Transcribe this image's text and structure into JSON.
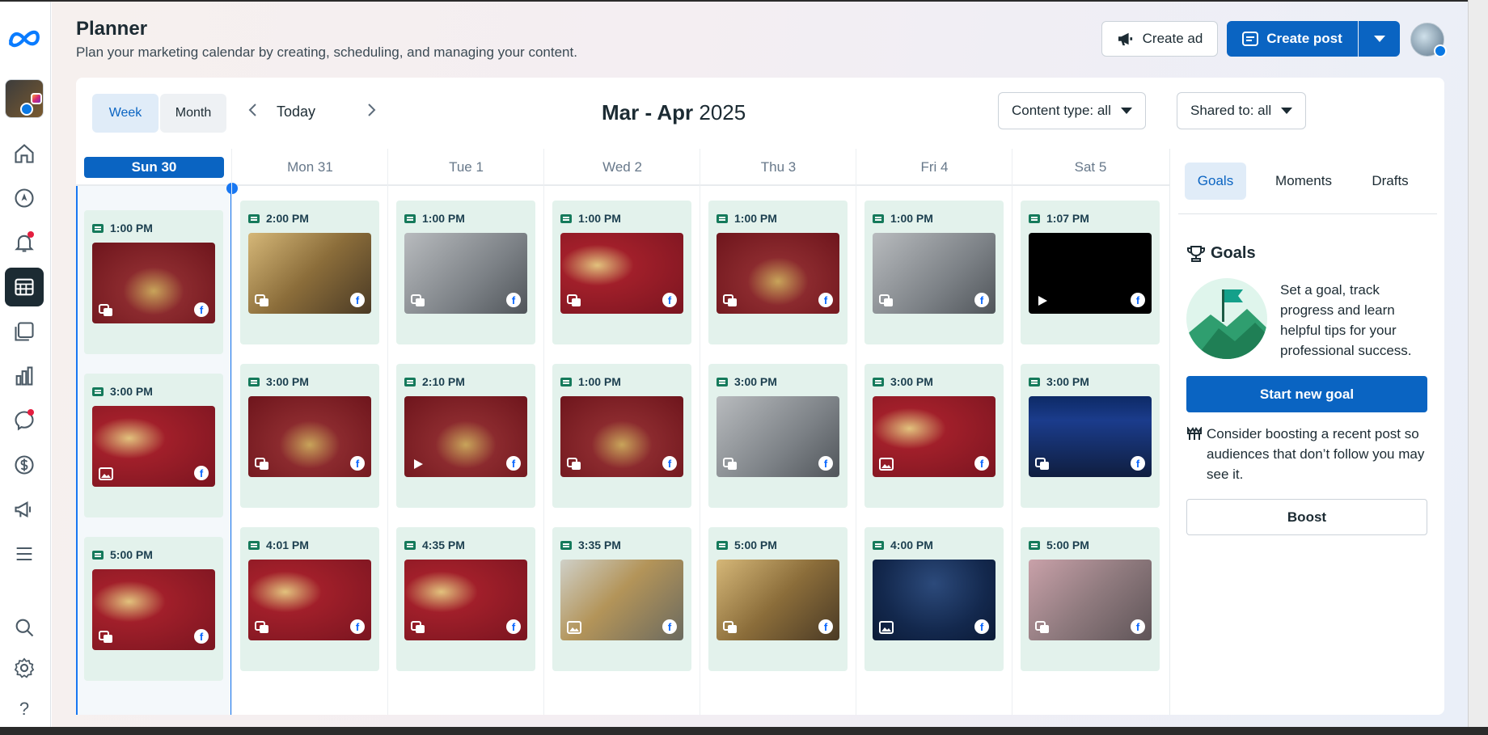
{
  "header": {
    "title": "Planner",
    "subtitle": "Plan your marketing calendar by creating, scheduling, and managing your content.",
    "create_ad_label": "Create ad",
    "create_post_label": "Create post"
  },
  "rail": {
    "icons": [
      "meta-logo-icon",
      "account-avatar",
      "home-icon",
      "compass-icon",
      "bell-icon",
      "planner-icon",
      "content-icon",
      "insights-icon",
      "inbox-icon",
      "monetization-icon",
      "ads-icon",
      "menu-icon",
      "search-icon",
      "settings-icon",
      "help-icon"
    ]
  },
  "toolbar": {
    "week_label": "Week",
    "month_label": "Month",
    "today_label": "Today",
    "range_bold": "Mar - Apr",
    "range_year": "2025",
    "content_type_label": "Content type: all",
    "shared_to_label": "Shared to: all"
  },
  "calendar": {
    "days": [
      {
        "label": "Sun 30",
        "today": true
      },
      {
        "label": "Mon 31"
      },
      {
        "label": "Tue 1"
      },
      {
        "label": "Wed 2"
      },
      {
        "label": "Thu 3"
      },
      {
        "label": "Fri 4"
      },
      {
        "label": "Sat 5"
      }
    ],
    "posts": [
      [
        {
          "time": "1:00 PM",
          "thumb": "th-red",
          "type": "carousel"
        },
        {
          "time": "3:00 PM",
          "thumb": "th-red2",
          "type": "photo"
        },
        {
          "time": "5:00 PM",
          "thumb": "th-red2",
          "type": "carousel"
        }
      ],
      [
        {
          "time": "2:00 PM",
          "thumb": "th-gold",
          "type": "carousel"
        },
        {
          "time": "3:00 PM",
          "thumb": "th-red",
          "type": "carousel"
        },
        {
          "time": "4:01 PM",
          "thumb": "th-red2",
          "type": "carousel"
        }
      ],
      [
        {
          "time": "1:00 PM",
          "thumb": "th-grey",
          "type": "carousel"
        },
        {
          "time": "2:10 PM",
          "thumb": "th-red",
          "type": "video"
        },
        {
          "time": "4:35 PM",
          "thumb": "th-red2",
          "type": "carousel"
        }
      ],
      [
        {
          "time": "1:00 PM",
          "thumb": "th-red2",
          "type": "carousel"
        },
        {
          "time": "1:00 PM",
          "thumb": "th-red",
          "type": "carousel"
        },
        {
          "time": "3:35 PM",
          "thumb": "th-teal",
          "type": "photo"
        }
      ],
      [
        {
          "time": "1:00 PM",
          "thumb": "th-red",
          "type": "carousel"
        },
        {
          "time": "3:00 PM",
          "thumb": "th-grey",
          "type": "carousel"
        },
        {
          "time": "5:00 PM",
          "thumb": "th-gold",
          "type": "carousel"
        }
      ],
      [
        {
          "time": "1:00 PM",
          "thumb": "th-grey",
          "type": "carousel"
        },
        {
          "time": "3:00 PM",
          "thumb": "th-red2",
          "type": "photo"
        },
        {
          "time": "4:00 PM",
          "thumb": "th-navy",
          "type": "photo"
        }
      ],
      [
        {
          "time": "1:07 PM",
          "thumb": "th-black",
          "type": "video"
        },
        {
          "time": "3:00 PM",
          "thumb": "th-phone",
          "type": "carousel"
        },
        {
          "time": "5:00 PM",
          "thumb": "th-pink",
          "type": "carousel"
        }
      ]
    ]
  },
  "side": {
    "tabs": [
      "Goals",
      "Moments",
      "Drafts"
    ],
    "goals_title": "Goals",
    "goals_text": "Set a goal, track progress and learn helpful tips for your professional success.",
    "start_goal_label": "Start new goal",
    "boost_text": "Consider boosting a recent post so audiences that don’t follow you may see it.",
    "boost_label": "Boost"
  },
  "colors": {
    "accent": "#0a64c2",
    "post_bg": "#e3f2ec",
    "now_line": "#1877f2"
  }
}
